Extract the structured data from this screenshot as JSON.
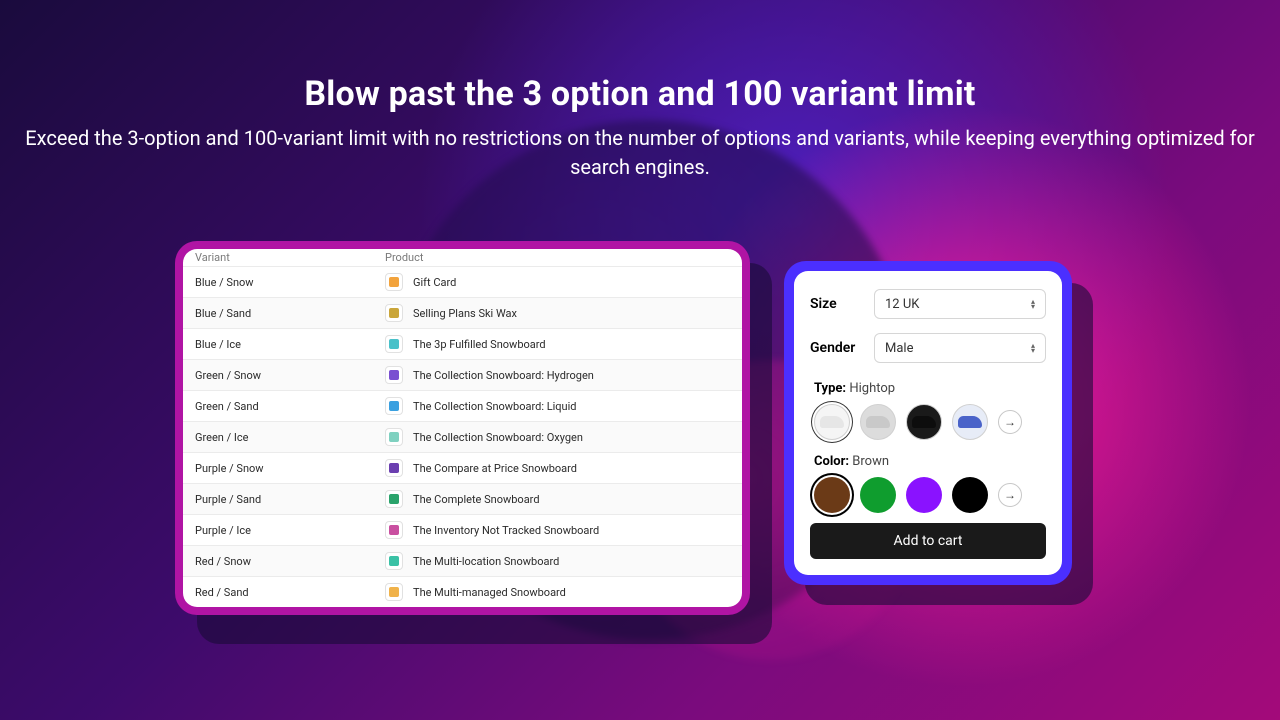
{
  "headline": {
    "title": "Blow past the 3 option and 100 variant limit",
    "subtitle": "Exceed the 3-option and 100-variant limit with no restrictions on the number of options and variants, while keeping everything optimized for search engines."
  },
  "table": {
    "header_variant": "Variant",
    "header_product": "Product",
    "rows": [
      {
        "variant": "Blue / Snow",
        "product": "Gift Card",
        "thumb": "#f2a33c"
      },
      {
        "variant": "Blue / Sand",
        "product": "Selling Plans Ski Wax",
        "thumb": "#caa63a"
      },
      {
        "variant": "Blue / Ice",
        "product": "The 3p Fulfilled Snowboard",
        "thumb": "#49c1c9"
      },
      {
        "variant": "Green / Snow",
        "product": "The Collection Snowboard: Hydrogen",
        "thumb": "#7a4fd1"
      },
      {
        "variant": "Green / Sand",
        "product": "The Collection Snowboard: Liquid",
        "thumb": "#3aa0e0"
      },
      {
        "variant": "Green / Ice",
        "product": "The Collection Snowboard: Oxygen",
        "thumb": "#7fd1c0"
      },
      {
        "variant": "Purple / Snow",
        "product": "The Compare at Price Snowboard",
        "thumb": "#6b3fb0"
      },
      {
        "variant": "Purple / Sand",
        "product": "The Complete Snowboard",
        "thumb": "#2aa36b"
      },
      {
        "variant": "Purple / Ice",
        "product": "The Inventory Not Tracked Snowboard",
        "thumb": "#c94fa0"
      },
      {
        "variant": "Red / Snow",
        "product": "The Multi-location Snowboard",
        "thumb": "#3ac1a5"
      },
      {
        "variant": "Red / Sand",
        "product": "The Multi-managed Snowboard",
        "thumb": "#f0b24a"
      }
    ]
  },
  "product_panel": {
    "size_label": "Size",
    "size_value": "12 UK",
    "gender_label": "Gender",
    "gender_value": "Male",
    "type_label": "Type:",
    "type_value": "Hightop",
    "color_label": "Color:",
    "color_value": "Brown",
    "shoe_swatches": [
      {
        "bg": "#f5f5f5",
        "shoe": "#e6e6e6",
        "selected": true
      },
      {
        "bg": "#dcdcdc",
        "shoe": "#c9c9c9",
        "selected": false
      },
      {
        "bg": "#1a1a1a",
        "shoe": "#0d0d0d",
        "selected": false
      },
      {
        "bg": "#e7ecf7",
        "shoe": "#4a63c9",
        "selected": false
      }
    ],
    "color_swatches": [
      {
        "hex": "#6b3a17",
        "selected": true
      },
      {
        "hex": "#0f9d2e",
        "selected": false
      },
      {
        "hex": "#8a12ff",
        "selected": false
      },
      {
        "hex": "#000000",
        "selected": false
      }
    ],
    "arrow_glyph": "→",
    "add_label": "Add to cart"
  }
}
